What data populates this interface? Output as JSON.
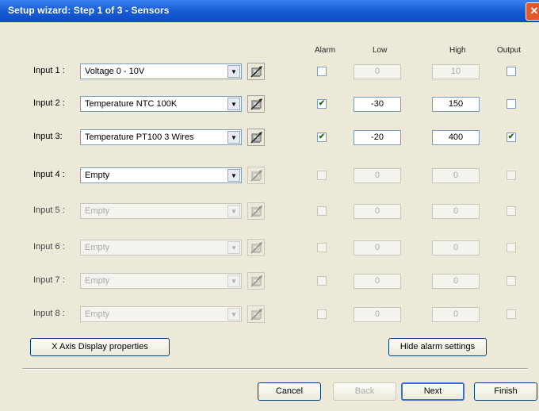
{
  "window": {
    "title": "Setup wizard: Step 1 of 3 - Sensors",
    "close_symbol": "✕"
  },
  "columns": {
    "alarm": "Alarm",
    "low": "Low",
    "high": "High",
    "output": "Output"
  },
  "inputs": [
    {
      "label": "Input 1 :",
      "sensor": "Voltage 0 - 10V",
      "enabled": true,
      "alarm": false,
      "low": "0",
      "high": "10",
      "limits_enabled": false,
      "output": false
    },
    {
      "label": "Input 2 :",
      "sensor": "Temperature NTC 100K",
      "enabled": true,
      "alarm": true,
      "low": "-30",
      "high": "150",
      "limits_enabled": true,
      "output": false
    },
    {
      "label": "Input 3:",
      "sensor": "Temperature PT100 3 Wires",
      "enabled": true,
      "alarm": true,
      "low": "-20",
      "high": "400",
      "limits_enabled": true,
      "output": true
    },
    {
      "label": "Input 4 :",
      "sensor": "Empty",
      "enabled": true,
      "alarm": false,
      "low": "0",
      "high": "0",
      "limits_enabled": false,
      "output": false
    },
    {
      "label": "Input 5 :",
      "sensor": "Empty",
      "enabled": false,
      "alarm": false,
      "low": "0",
      "high": "0",
      "limits_enabled": false,
      "output": false
    },
    {
      "label": "Input 6 :",
      "sensor": "Empty",
      "enabled": false,
      "alarm": false,
      "low": "0",
      "high": "0",
      "limits_enabled": false,
      "output": false
    },
    {
      "label": "Input 7 :",
      "sensor": "Empty",
      "enabled": false,
      "alarm": false,
      "low": "0",
      "high": "0",
      "limits_enabled": false,
      "output": false
    },
    {
      "label": "Input 8 :",
      "sensor": "Empty",
      "enabled": false,
      "alarm": false,
      "low": "0",
      "high": "0",
      "limits_enabled": false,
      "output": false
    }
  ],
  "icons": {
    "configure": "sensor-configure-icon",
    "check": "✔",
    "dropdown": "▼"
  },
  "buttons": {
    "x_axis": "X Axis Display properties",
    "hide_alarm": "Hide alarm settings",
    "cancel": "Cancel",
    "back": "Back",
    "next": "Next",
    "finish": "Finish"
  },
  "colors": {
    "titlebar": "#0a4bc4",
    "dialog_bg": "#ece9d8",
    "close": "#e2582a",
    "check": "#1c6b1c"
  }
}
